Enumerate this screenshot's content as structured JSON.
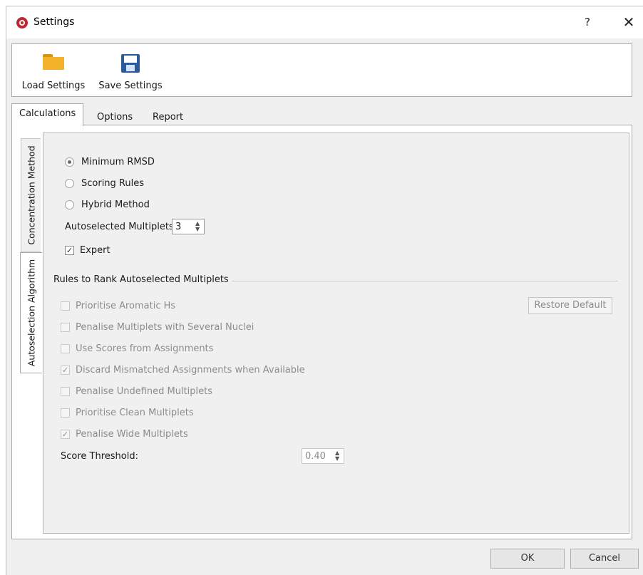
{
  "window": {
    "title": "Settings",
    "help_label": "?",
    "close_label": "✕",
    "app_icon": "app-logo-icon"
  },
  "toolbar": {
    "load_label": "Load Settings",
    "load_icon": "folder-icon",
    "save_label": "Save Settings",
    "save_icon": "floppy-disk-icon"
  },
  "tabs": [
    {
      "label": "Calculations",
      "active": true
    },
    {
      "label": "Options",
      "active": false
    },
    {
      "label": "Report",
      "active": false
    }
  ],
  "side_tabs": [
    {
      "label": "Concentration Method",
      "active": false
    },
    {
      "label": "Autoselection Algorithm",
      "active": true
    }
  ],
  "algorithm": {
    "options": [
      {
        "label": "Minimum RMSD",
        "selected": true
      },
      {
        "label": "Scoring Rules",
        "selected": false
      },
      {
        "label": "Hybrid Method",
        "selected": false
      }
    ],
    "multiplets_label": "Autoselected Multiplets",
    "multiplets_value": "3",
    "expert_label": "Expert",
    "expert_checked": true
  },
  "rules": {
    "group_title": "Rules to Rank Autoselected Multiplets",
    "restore_label": "Restore Default",
    "items": [
      {
        "label": "Prioritise Aromatic Hs",
        "checked": false
      },
      {
        "label": "Penalise Multiplets with Several Nuclei",
        "checked": false
      },
      {
        "label": "Use Scores from Assignments",
        "checked": false
      },
      {
        "label": "Discard Mismatched Assignments when Available",
        "checked": true
      },
      {
        "label": "Penalise Undefined Multiplets",
        "checked": false
      },
      {
        "label": "Prioritise Clean Multiplets",
        "checked": false
      },
      {
        "label": "Penalise Wide Multiplets",
        "checked": true
      }
    ],
    "threshold_label": "Score Threshold:",
    "threshold_value": "0.40"
  },
  "footer": {
    "ok_label": "OK",
    "cancel_label": "Cancel"
  },
  "colors": {
    "app_icon": "#c0282e",
    "folder": "#f2b32a",
    "floppy": "#2c5a9a",
    "disabled_text": "#8c8c8c"
  }
}
